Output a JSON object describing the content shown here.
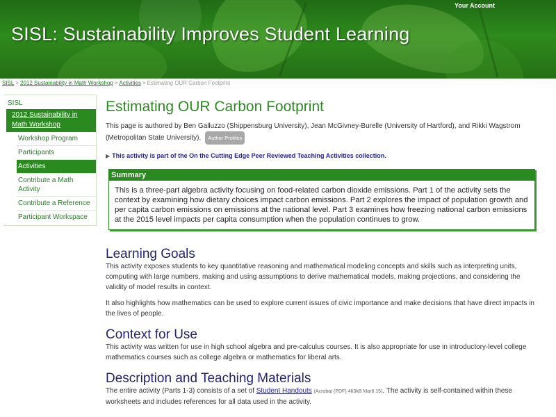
{
  "header": {
    "account_label": "Your Account",
    "site_title": "SISL: Sustainability Improves Student Learning"
  },
  "breadcrumb": {
    "items": [
      "SISL",
      "2012 Sustainability in Math Workshop",
      "Activities"
    ],
    "current": "Estimating OUR Carbon Footprint",
    "separator": ">"
  },
  "sidebar": {
    "top_link": "SISL",
    "group": "2012 Sustainability in Math Workshop",
    "items": [
      {
        "label": "Workshop Program",
        "active": false
      },
      {
        "label": "Participants",
        "active": false
      },
      {
        "label": "Activities",
        "active": true
      },
      {
        "label": "Contribute a Math Activity",
        "active": false
      },
      {
        "label": "Contribute a Reference",
        "active": false
      },
      {
        "label": "Participant Workspace",
        "active": false
      }
    ]
  },
  "main": {
    "title": "Estimating OUR Carbon Footprint",
    "byline": "This page is authored by Ben Galluzzo (Shippensburg University), Jean McGivney-Burelle (University of Hartford), and Rikki Wagstrom (Metropolitan State University).",
    "author_button": "Author Profiles",
    "collection_note": "This activity is part of the On the Cutting Edge Peer Reviewed Teaching Activities collection.",
    "summary": {
      "heading": "Summary",
      "text": "This is a three-part algebra activity focusing on food-related carbon dioxide emissions. Part 1 of the activity sets the context by examining how dietary choices impact carbon emissions. Part 2 explores the impact of population growth and per capita carbon emissions on emissions at the national level. Part 3 examines how freezing national carbon emissions at the 2015 level impacts per capita consumption when the population continues to grow."
    },
    "learning_goals": {
      "heading": "Learning Goals",
      "p1": "This activity exposes students to key quantitative reasoning and mathematical modeling concepts and skills such as interpreting units, computing with large numbers, making and using assumptions to derive mathematical models, making projections, and considering the validity of model results in context.",
      "p2": "It also highlights how mathematics can be used to explore current issues of civic importance and make decisions that have direct impacts in the lives of people."
    },
    "context": {
      "heading": "Context for Use",
      "p1": "This activity was written for use in high school algebra and pre-calculus courses. It is also appropriate for use in introductory-level college mathematics courses such as college algebra or mathematics for liberal arts."
    },
    "description": {
      "heading": "Description and Teaching Materials",
      "p_before": "The entire activity (Parts 1-3) consists of a set of ",
      "link": "Student Handouts",
      "meta": "(Acrobat (PDF) 463kB Mar6 15)",
      "p_after": ". The activity is self-contained within these worksheets and includes references for all data used in the activity."
    }
  },
  "colors": {
    "brand_green": "#2a8a20",
    "heading_navy": "#22226e",
    "link_blue": "#22229a"
  }
}
